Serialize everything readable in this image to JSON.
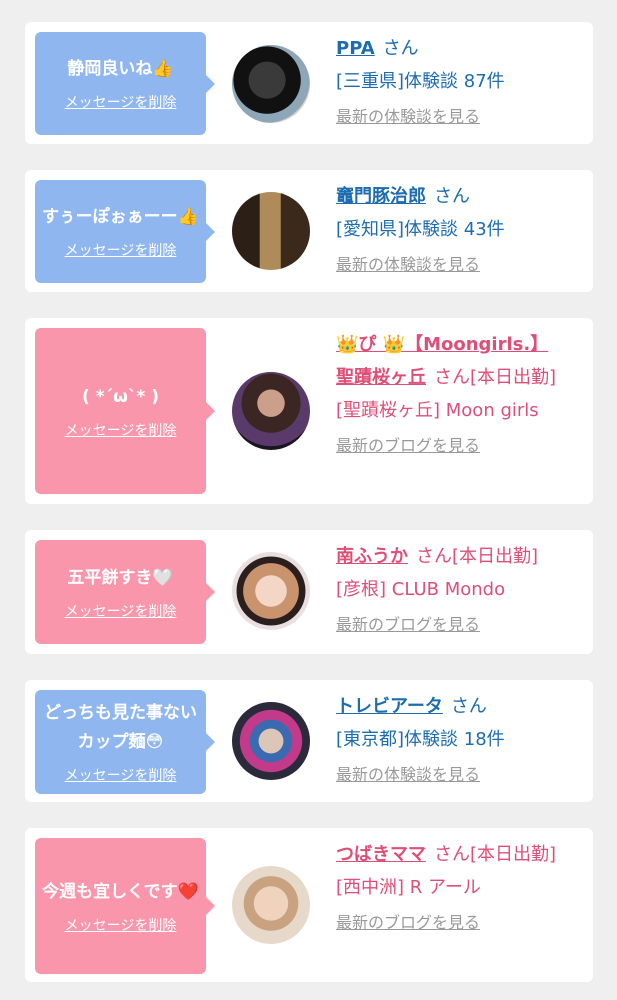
{
  "delete_label": "メッセージを削除",
  "san_label": "さん",
  "cards": [
    {
      "bubble_color": "blue",
      "message": "静岡良いね👍",
      "name": "PPA",
      "san": "さん",
      "detail": "[三重県]体験談 87件",
      "more": "最新の体験談を見る"
    },
    {
      "bubble_color": "blue",
      "message": "すぅーぽぉぁーー👍",
      "name": "竈門豚治郎",
      "san": "さん",
      "detail": "[愛知県]体験談 43件",
      "more": "最新の体験談を見る"
    },
    {
      "bubble_color": "pink",
      "message": "( *´ω`* )",
      "name_line1": "👑ぴ 👑【Moongirls.】",
      "name_line2": "聖蹟桜ヶ丘",
      "san": "さん[本日出勤]",
      "detail": "[聖蹟桜ヶ丘] Moon girls",
      "more": "最新のブログを見る"
    },
    {
      "bubble_color": "pink",
      "message": "五平餅すき🤍",
      "name": "南ふうか",
      "san": "さん[本日出勤]",
      "detail": "[彦根] CLUB Mondo",
      "more": "最新のブログを見る"
    },
    {
      "bubble_color": "blue",
      "message": "どっちも見た事ないカップ麺😳",
      "name": "トレビアータ",
      "san": "さん",
      "detail": "[東京都]体験談 18件",
      "more": "最新の体験談を見る"
    },
    {
      "bubble_color": "pink",
      "message": "今週も宜しくです❤️",
      "name": "つばきママ",
      "san": "さん[本日出勤]",
      "detail": "[西中洲] R アール",
      "more": "最新のブログを見る"
    }
  ],
  "colors": {
    "blue_bubble": "#8fb6ef",
    "pink_bubble": "#f996ac",
    "link_blue": "#1e6cb0",
    "link_pink": "#de4f77"
  }
}
